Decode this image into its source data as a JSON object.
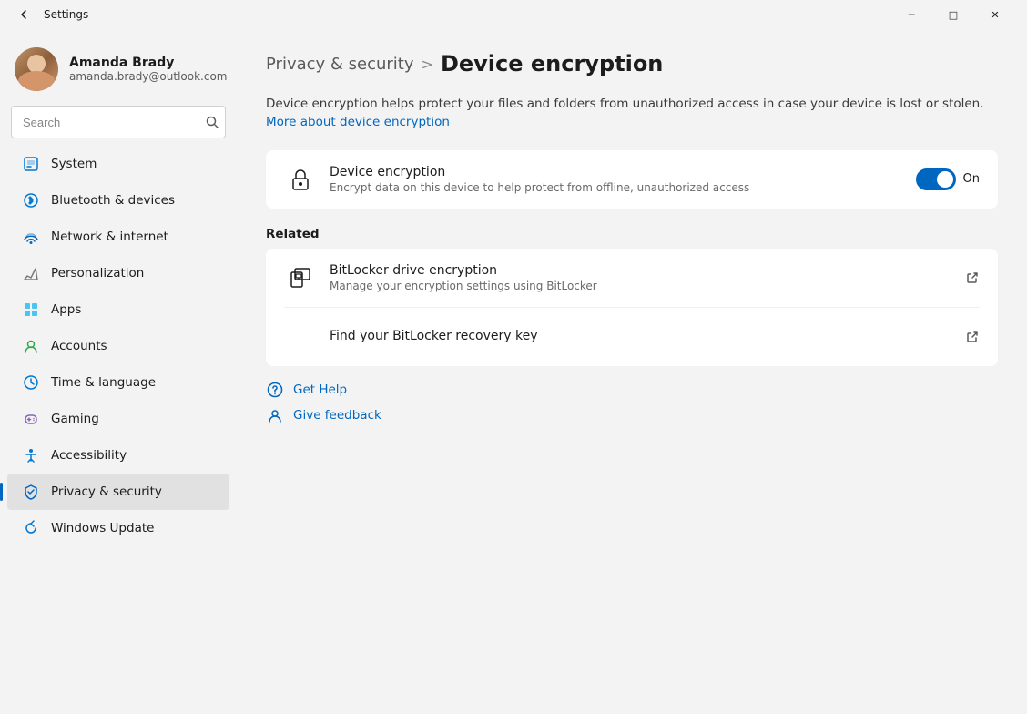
{
  "window": {
    "title": "Settings",
    "controls": {
      "minimize": "─",
      "maximize": "□",
      "close": "✕"
    }
  },
  "sidebar": {
    "profile": {
      "name": "Amanda Brady",
      "email": "amanda.brady@outlook.com"
    },
    "search": {
      "placeholder": "Search"
    },
    "nav_items": [
      {
        "id": "system",
        "label": "System",
        "icon": "system-icon"
      },
      {
        "id": "bluetooth",
        "label": "Bluetooth & devices",
        "icon": "bluetooth-icon"
      },
      {
        "id": "network",
        "label": "Network & internet",
        "icon": "network-icon"
      },
      {
        "id": "personalization",
        "label": "Personalization",
        "icon": "personalization-icon"
      },
      {
        "id": "apps",
        "label": "Apps",
        "icon": "apps-icon"
      },
      {
        "id": "accounts",
        "label": "Accounts",
        "icon": "accounts-icon"
      },
      {
        "id": "time",
        "label": "Time & language",
        "icon": "time-icon"
      },
      {
        "id": "gaming",
        "label": "Gaming",
        "icon": "gaming-icon"
      },
      {
        "id": "accessibility",
        "label": "Accessibility",
        "icon": "accessibility-icon"
      },
      {
        "id": "privacy",
        "label": "Privacy & security",
        "icon": "privacy-icon",
        "active": true
      },
      {
        "id": "update",
        "label": "Windows Update",
        "icon": "update-icon"
      }
    ]
  },
  "main": {
    "breadcrumb_parent": "Privacy & security",
    "breadcrumb_sep": ">",
    "page_title": "Device encryption",
    "description": "Device encryption helps protect your files and folders from unauthorized access in case your device is lost or stolen.",
    "description_link_text": "More about device encryption",
    "main_card": {
      "title": "Device encryption",
      "subtitle": "Encrypt data on this device to help protect from offline, unauthorized access",
      "toggle_state": "On"
    },
    "related_section": {
      "title": "Related",
      "items": [
        {
          "title": "BitLocker drive encryption",
          "subtitle": "Manage your encryption settings using BitLocker",
          "has_external_link": true
        },
        {
          "title": "Find your BitLocker recovery key",
          "has_external_link": true
        }
      ]
    },
    "help": {
      "get_help_label": "Get Help",
      "give_feedback_label": "Give feedback"
    }
  },
  "colors": {
    "accent": "#0067c0",
    "toggle_on": "#0067c0",
    "active_nav_indicator": "#0067c0"
  }
}
